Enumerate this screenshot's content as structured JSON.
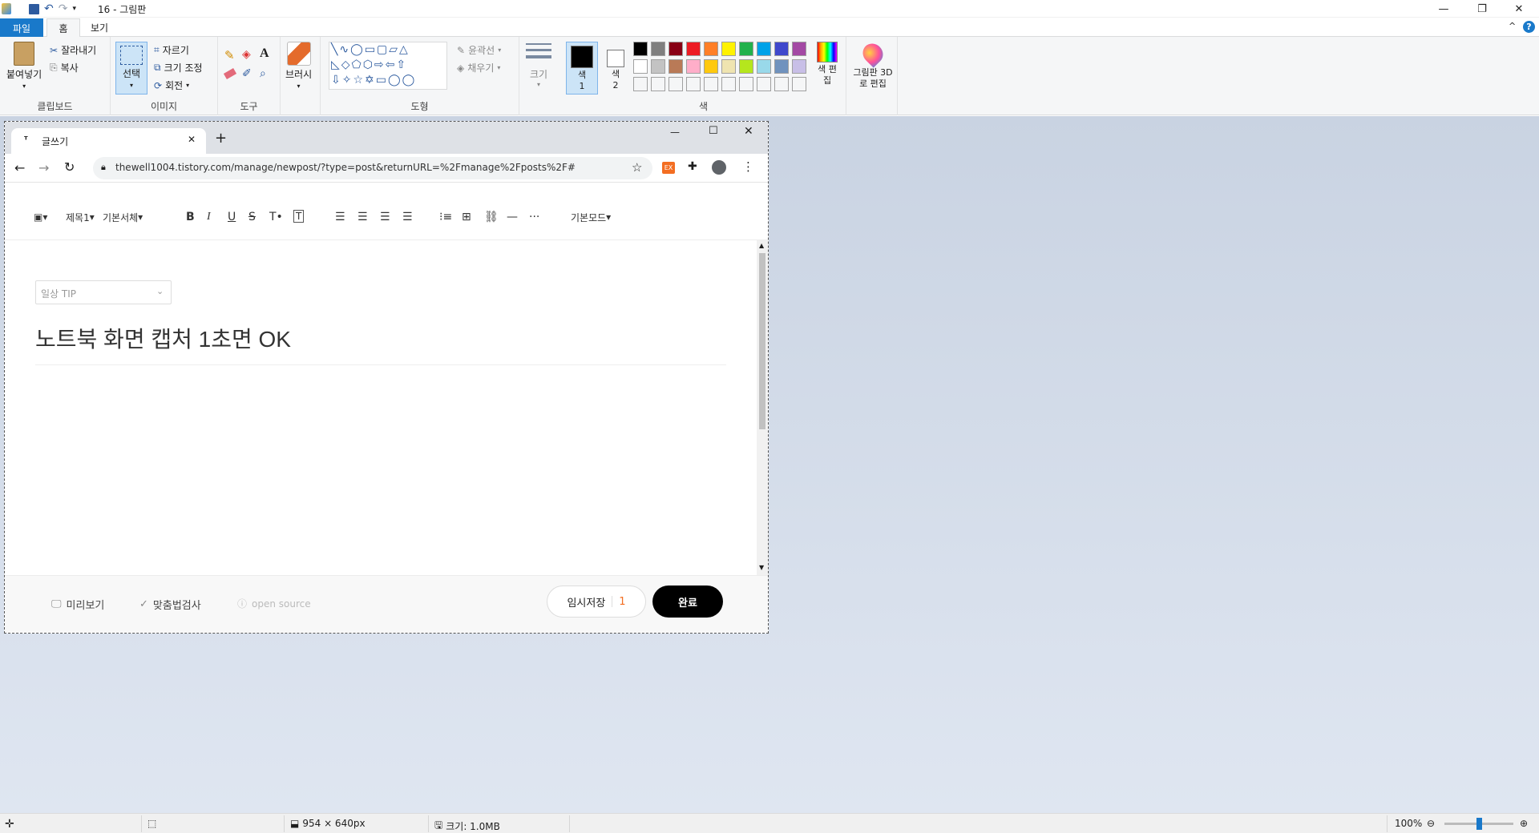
{
  "window": {
    "title": "16 - 그림판",
    "minimize": "—",
    "maximize": "❐",
    "close": "✕"
  },
  "tabs": {
    "file": "파일",
    "home": "홈",
    "view": "보기"
  },
  "ribbon": {
    "clipboard": {
      "paste": "붙여넣기",
      "cut": "잘라내기",
      "copy": "복사",
      "label": "클립보드"
    },
    "image": {
      "select": "선택",
      "crop": "자르기",
      "resize": "크기 조정",
      "rotate": "회전",
      "label": "이미지"
    },
    "tools": {
      "label": "도구"
    },
    "brushes": {
      "label": "브러시"
    },
    "shapes": {
      "outline": "윤곽선",
      "fill": "채우기",
      "label": "도형"
    },
    "size": {
      "label": "크기"
    },
    "colors": {
      "color1": "색 1",
      "color2": "색 2",
      "edit": "색 편집",
      "label": "색",
      "palette_row1": [
        "#000000",
        "#7f7f7f",
        "#880015",
        "#ed1c24",
        "#ff7f27",
        "#fff200",
        "#22b14c",
        "#00a2e8",
        "#3f48cc",
        "#a349a4"
      ],
      "palette_row2": [
        "#ffffff",
        "#c3c3c3",
        "#b97a57",
        "#ffaec9",
        "#ffc90e",
        "#efe4b0",
        "#b5e61d",
        "#99d9ea",
        "#7092be",
        "#c8bfe7"
      ]
    },
    "paint3d": {
      "label": "그림판 3D로 편집"
    }
  },
  "browser": {
    "tab_title": "글쓰기",
    "url": "thewell1004.tistory.com/manage/newpost/?type=post&returnURL=%2Fmanage%2Fposts%2F#"
  },
  "editor": {
    "toolbar": {
      "heading": "제목1",
      "font": "기본서체",
      "mode": "기본모드"
    },
    "category": "일상 TIP",
    "post_title": "노트북 화면 캡처 1초면 OK",
    "bottom": {
      "preview": "미리보기",
      "spellcheck": "맞춤법검사",
      "opensource": "open source",
      "temp_save": "임시저장",
      "temp_count": "1",
      "done": "완료"
    }
  },
  "status": {
    "dimensions": "954 × 640px",
    "filesize": "크기: 1.0MB",
    "zoom": "100%"
  }
}
